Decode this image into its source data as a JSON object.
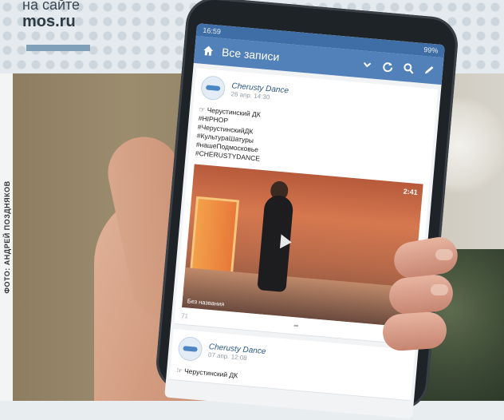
{
  "banner": {
    "line1": "на сайте",
    "line2": "mos.ru"
  },
  "credit": "ФОТО: АНДРЕЙ ПОЗДНЯКОВ",
  "phone": {
    "statusbar": {
      "time": "16:59",
      "battery": "99%"
    },
    "appbar": {
      "title": "Все записи",
      "icons": [
        "home-icon",
        "chevron-down-icon",
        "refresh-icon",
        "search-icon",
        "edit-icon"
      ]
    },
    "posts": [
      {
        "author": "Cherusty Dance",
        "date": "26 апр. 14:30",
        "lines": [
          "☞ Черустинский ДК",
          "#HIPHOP",
          "#ЧерустинскийДК",
          "#КультураШатуры",
          "#нашеПодмосковье",
          "#CHERUSTYDANCE"
        ],
        "video": {
          "duration": "2:41",
          "caption": "Без названия"
        },
        "footer": {
          "views": "71"
        }
      },
      {
        "author": "Cherusty Dance",
        "date": "07 апр. 12:08",
        "lines": [
          "☞ Черустинский ДК"
        ]
      }
    ]
  },
  "colors": {
    "appbar": "#5181b8",
    "statusbar": "#3f6ea6",
    "banner_accent": "#7fa0b8"
  }
}
